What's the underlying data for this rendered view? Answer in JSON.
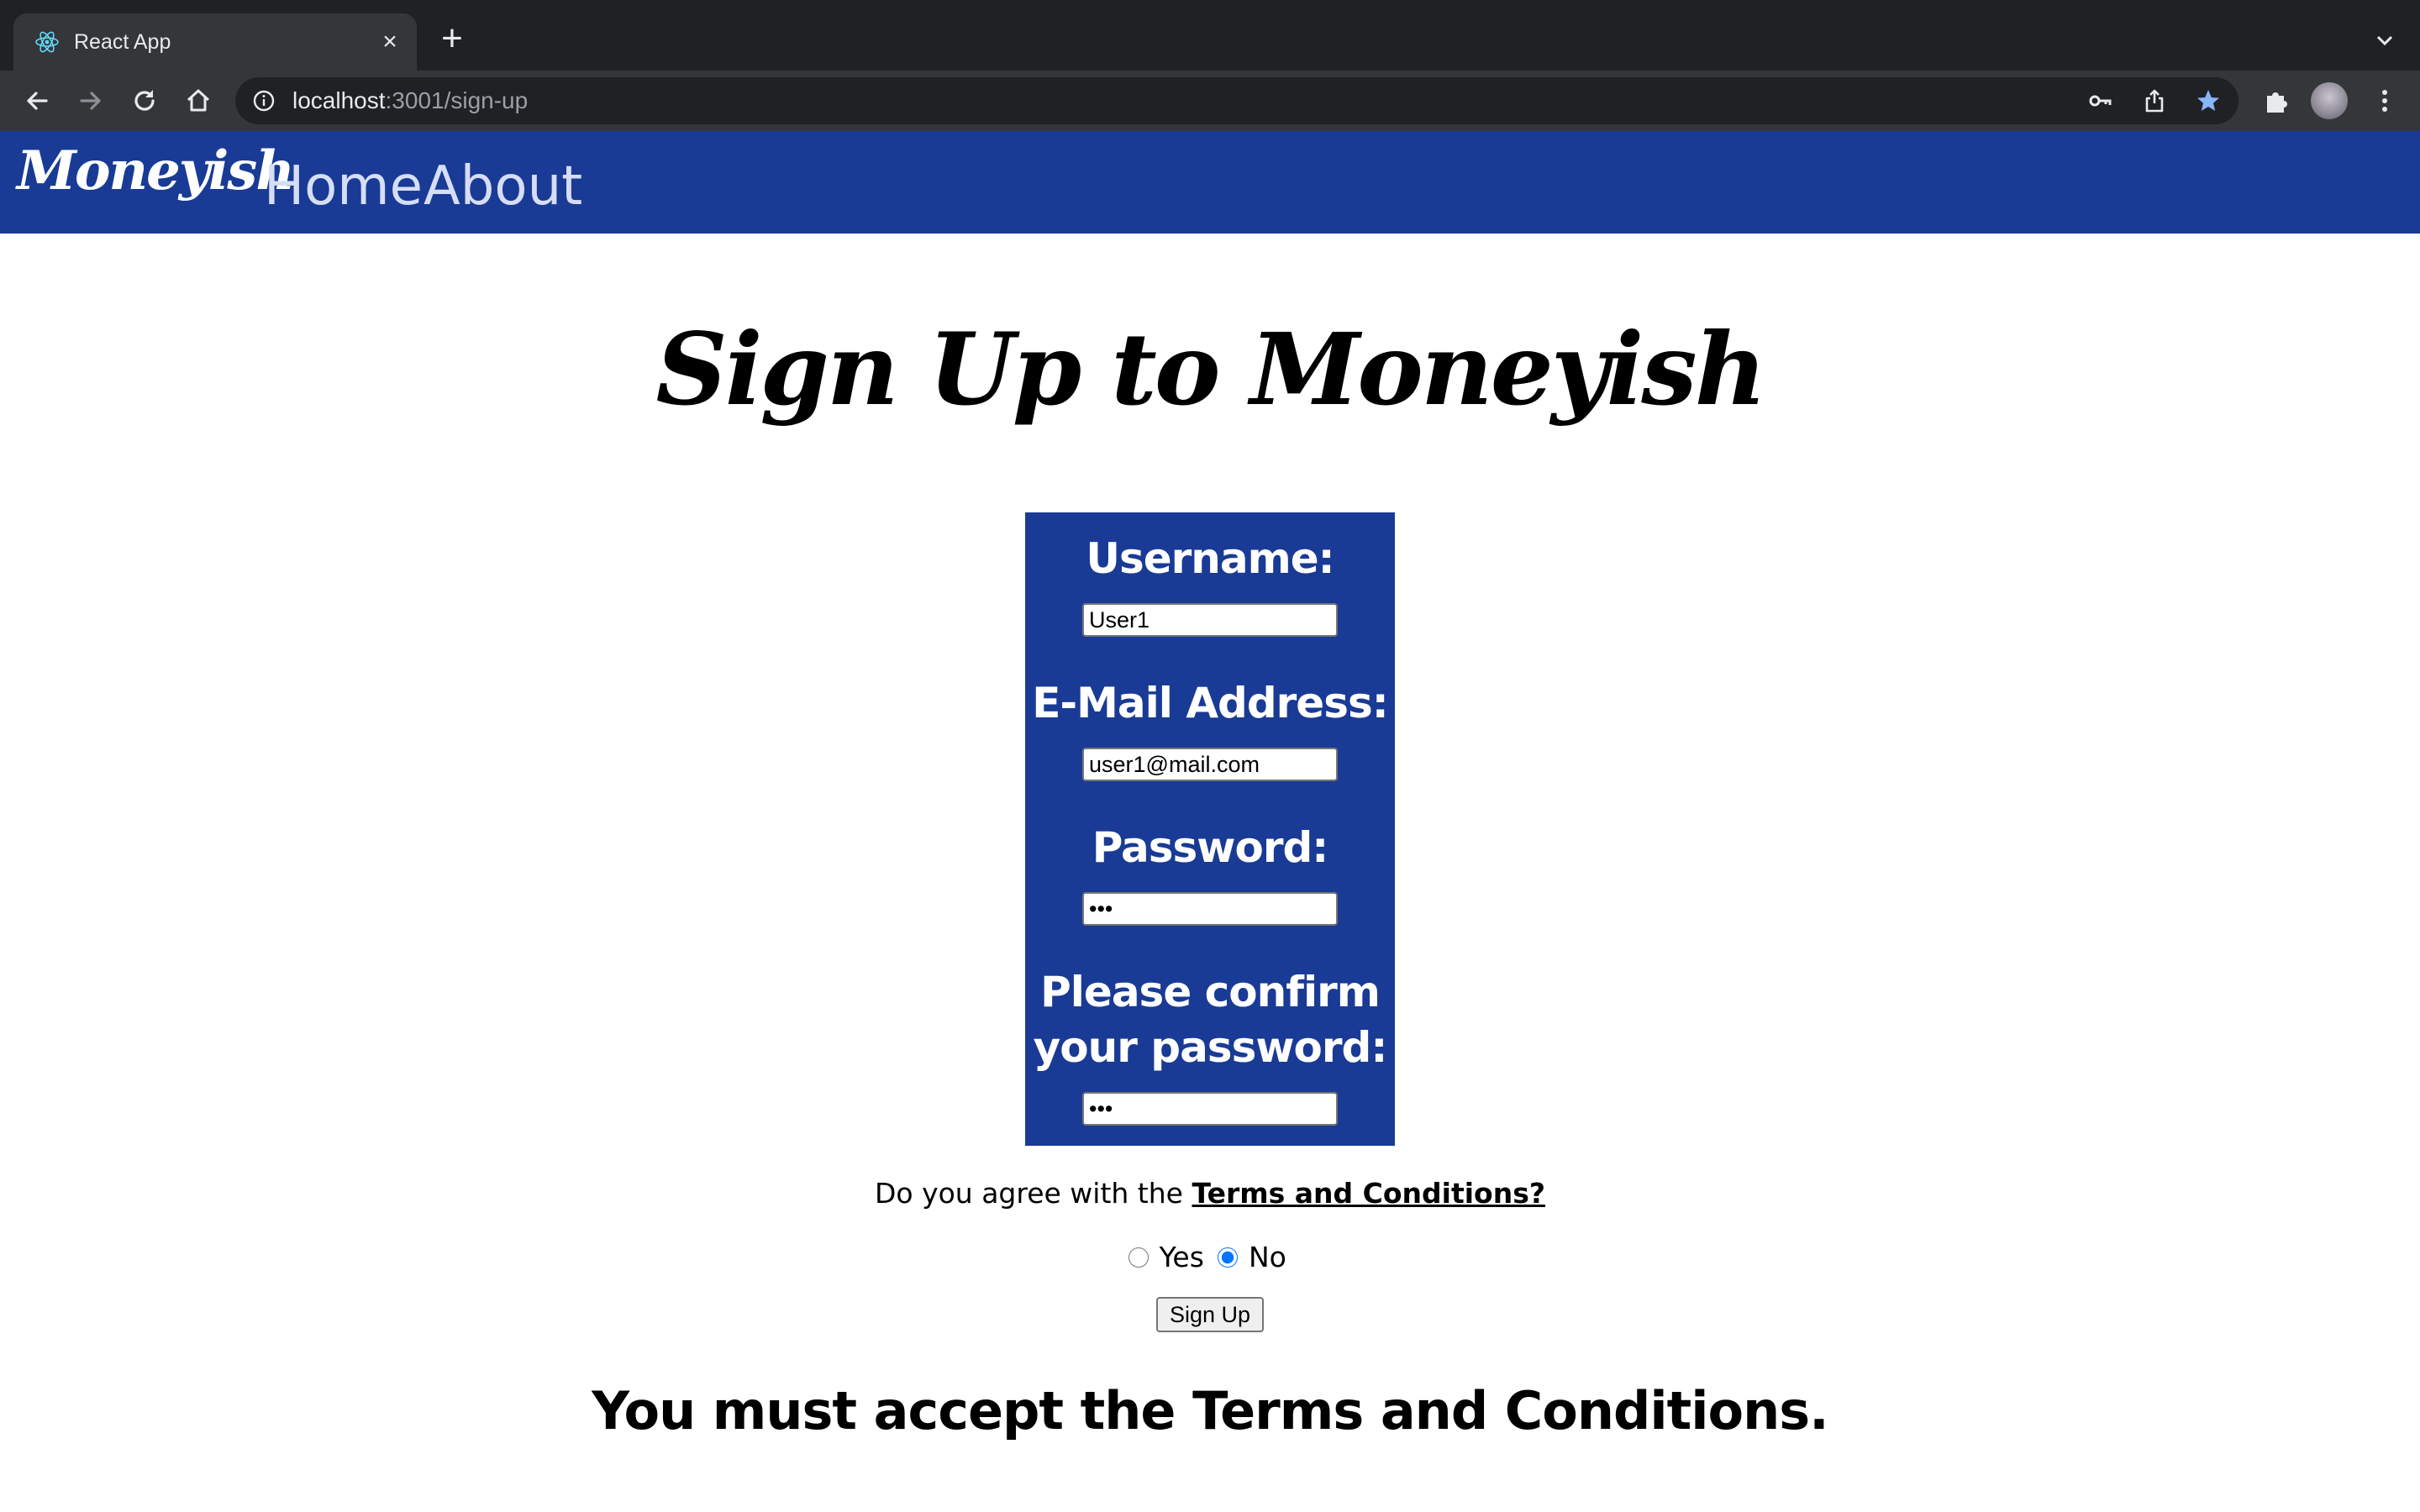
{
  "browser": {
    "tab_title": "React App",
    "tab_close": "×",
    "new_tab": "+",
    "url_host": "localhost",
    "url_path": ":3001/sign-up"
  },
  "navbar": {
    "logo": "Moneyish",
    "links": [
      {
        "label": "Home"
      },
      {
        "label": "About"
      }
    ]
  },
  "page": {
    "title": "Sign Up to Moneyish"
  },
  "form": {
    "username_label": "Username:",
    "username_value": "User1",
    "email_label": "E-Mail Address:",
    "email_value": "user1@mail.com",
    "password_label": "Password:",
    "password_value": "abc",
    "confirm_label_line1": "Please confirm",
    "confirm_label_line2": "your password:",
    "confirm_value": "abc"
  },
  "terms": {
    "question": "Do you agree with the ",
    "link": "Terms and Conditions?",
    "option_yes": "Yes",
    "option_no": "No",
    "selected": "No"
  },
  "submit": {
    "label": "Sign Up"
  },
  "error": {
    "message": "You must accept the Terms and Conditions."
  },
  "colors": {
    "brand_blue": "#193b95",
    "chrome_dark": "#202124",
    "chrome_toolbar": "#35363a",
    "bookmark_star": "#8ab4f8"
  }
}
